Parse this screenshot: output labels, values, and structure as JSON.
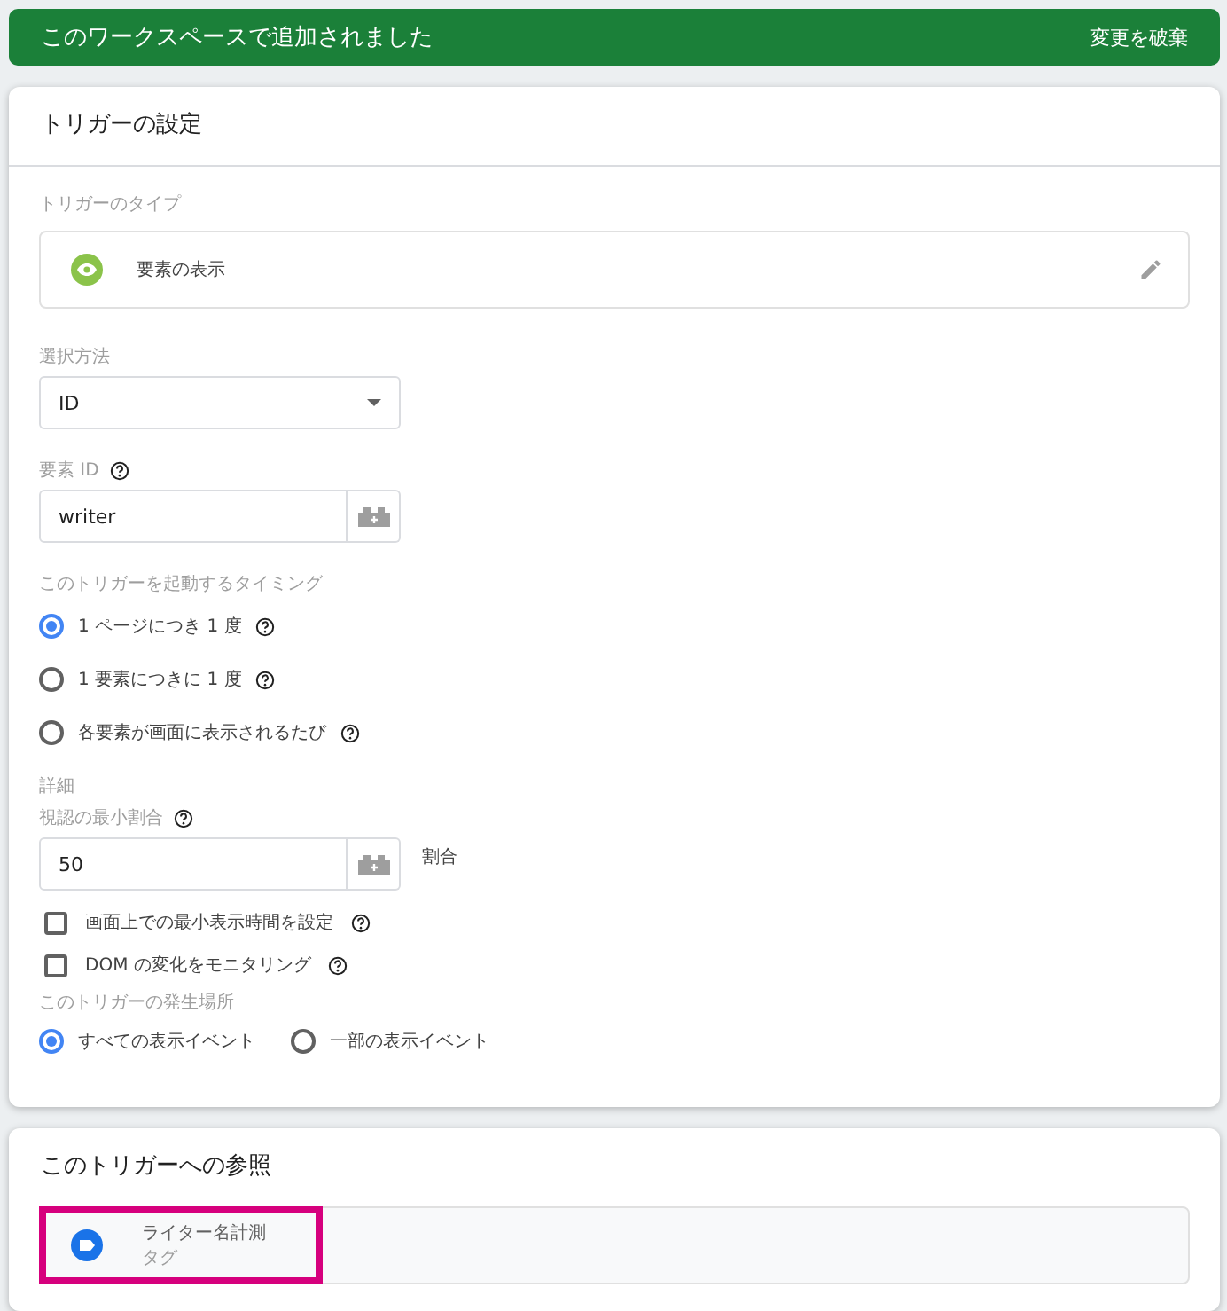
{
  "banner": {
    "message": "このワークスペースで追加されました",
    "action": "変更を破棄"
  },
  "trigger_config": {
    "title": "トリガーの設定",
    "type_label": "トリガーのタイプ",
    "type_value": "要素の表示",
    "selection_label": "選択方法",
    "selection_value": "ID",
    "element_id_label": "要素 ID",
    "element_id_value": "writer",
    "timing_label": "このトリガーを起動するタイミング",
    "timing_options": [
      {
        "label": "1 ページにつき 1 度",
        "selected": true
      },
      {
        "label": "1 要素につきに 1 度",
        "selected": false
      },
      {
        "label": "各要素が画面に表示されるたび",
        "selected": false
      }
    ],
    "advanced_label": "詳細",
    "min_ratio_label": "視認の最小割合",
    "min_ratio_value": "50",
    "min_ratio_unit": "割合",
    "checkboxes": [
      {
        "label": "画面上での最小表示時間を設定",
        "checked": false
      },
      {
        "label": "DOM の変化をモニタリング",
        "checked": false
      }
    ],
    "fire_on_label": "このトリガーの発生場所",
    "fire_on_options": [
      {
        "label": "すべての表示イベント",
        "selected": true
      },
      {
        "label": "一部の表示イベント",
        "selected": false
      }
    ]
  },
  "references": {
    "title": "このトリガーへの参照",
    "items": [
      {
        "name": "ライター名計測",
        "type": "タグ",
        "highlighted": true
      }
    ]
  }
}
